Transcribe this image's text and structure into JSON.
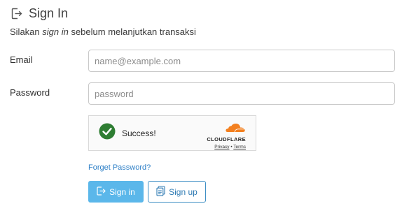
{
  "header": {
    "title": "Sign In",
    "subtitle_before": "Silakan ",
    "subtitle_emphasis": "sign in",
    "subtitle_after": " sebelum melanjutkan transaksi"
  },
  "form": {
    "email_label": "Email",
    "email_placeholder": "name@example.com",
    "email_value": "",
    "password_label": "Password",
    "password_placeholder": "password",
    "password_value": ""
  },
  "captcha": {
    "status_text": "Success!",
    "brand": "CLOUDFLARE",
    "privacy_link": "Privacy",
    "separator": "•",
    "terms_link": "Terms",
    "check_color": "#2e7d32",
    "brand_color": "#f38020"
  },
  "links": {
    "forget_password": "Forget Password?"
  },
  "buttons": {
    "signin_label": "Sign in",
    "signup_label": "Sign up"
  },
  "icons": {
    "title_icon": "sign-in-icon",
    "signin_icon": "sign-in-icon",
    "signup_icon": "clipboard-icon",
    "check_icon": "check-circle-icon",
    "cloud_icon": "cloudflare-cloud-icon"
  },
  "colors": {
    "primary": "#5bb7ea",
    "link": "#2f80c7",
    "outline": "#3f8fc4"
  }
}
